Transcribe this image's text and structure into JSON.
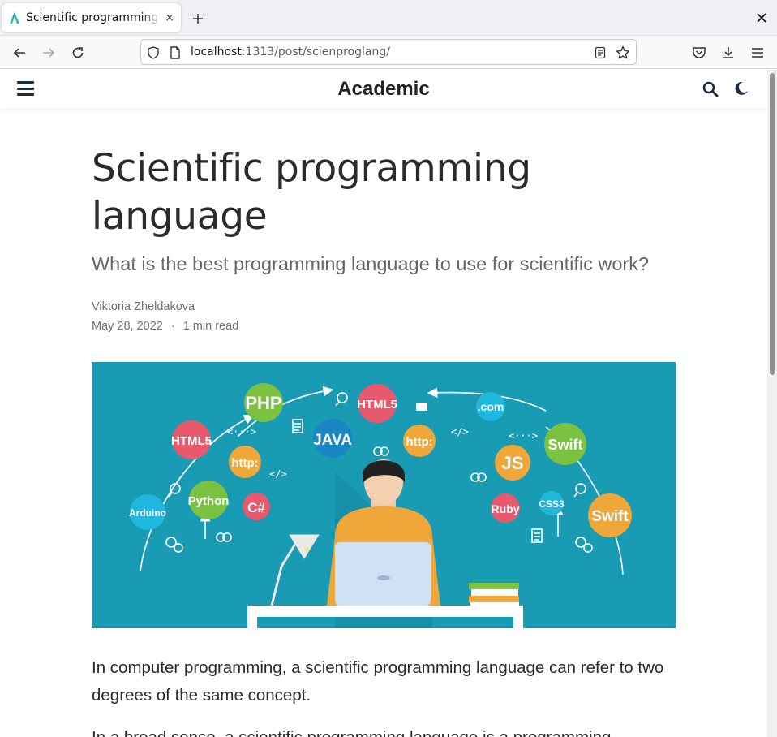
{
  "browser": {
    "tab": {
      "title": "Scientific programming language",
      "close": "×"
    },
    "new_tab": "+",
    "url": {
      "host": "localhost",
      "path": ":1313/post/scienproglang/"
    }
  },
  "site": {
    "brand": "Academic"
  },
  "article": {
    "title": "Scientific programming language",
    "subtitle": "What is the best programming language to use for scientific work?",
    "author": "Viktoria Zheldakova",
    "date": "May 28, 2022",
    "separator": "·",
    "read_time": "1 min read",
    "paragraphs": [
      "In computer programming, a scientific programming language can refer to two degrees of the same concept.",
      "In a broad sense, a scientific programming language is a programming"
    ]
  },
  "hero_labels": {
    "php": "PHP",
    "html5_top": "HTML5",
    "html5_left": "HTML5",
    "java": "JAVA",
    "http_left": "http:",
    "http_mid": "http:",
    "python": "Python",
    "csharp": "C#",
    "arduino": "Arduino",
    "dotcom": ".com",
    "swift_top": "Swift",
    "js": "JS",
    "ruby": "Ruby",
    "css3": "CSS3",
    "swift_bottom": "Swift",
    "code1": "<···>",
    "code2": "</>",
    "code3": "</>",
    "code4": "<···>"
  },
  "icons": {
    "back": "arrow-left-icon",
    "forward": "arrow-right-icon",
    "reload": "reload-icon",
    "shield": "shield-icon",
    "page": "page-icon",
    "reader": "reader-view-icon",
    "bookmark": "star-icon",
    "pocket": "pocket-icon",
    "downloads": "download-icon",
    "menu": "hamburger-icon",
    "search": "search-icon",
    "theme": "moon-icon"
  },
  "colors": {
    "hero_bg": "#1a9bb4",
    "accent": "#1a2c44"
  }
}
